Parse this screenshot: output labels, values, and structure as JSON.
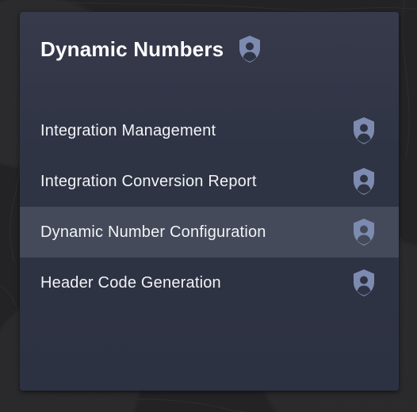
{
  "card": {
    "title": "Dynamic Numbers",
    "title_icon": "user-shield-icon"
  },
  "menu": {
    "items": [
      {
        "label": "Integration Management",
        "icon": "user-shield-icon",
        "active": false
      },
      {
        "label": "Integration Conversion Report",
        "icon": "user-shield-icon",
        "active": false
      },
      {
        "label": "Dynamic Number Configuration",
        "icon": "user-shield-icon",
        "active": true
      },
      {
        "label": "Header Code Generation",
        "icon": "user-shield-icon",
        "active": false
      }
    ]
  },
  "colors": {
    "page_background": "#232325",
    "card_background": "#2f3445",
    "active_row": "#444a59",
    "icon": "#7d8bb0",
    "text": "#ffffff"
  }
}
